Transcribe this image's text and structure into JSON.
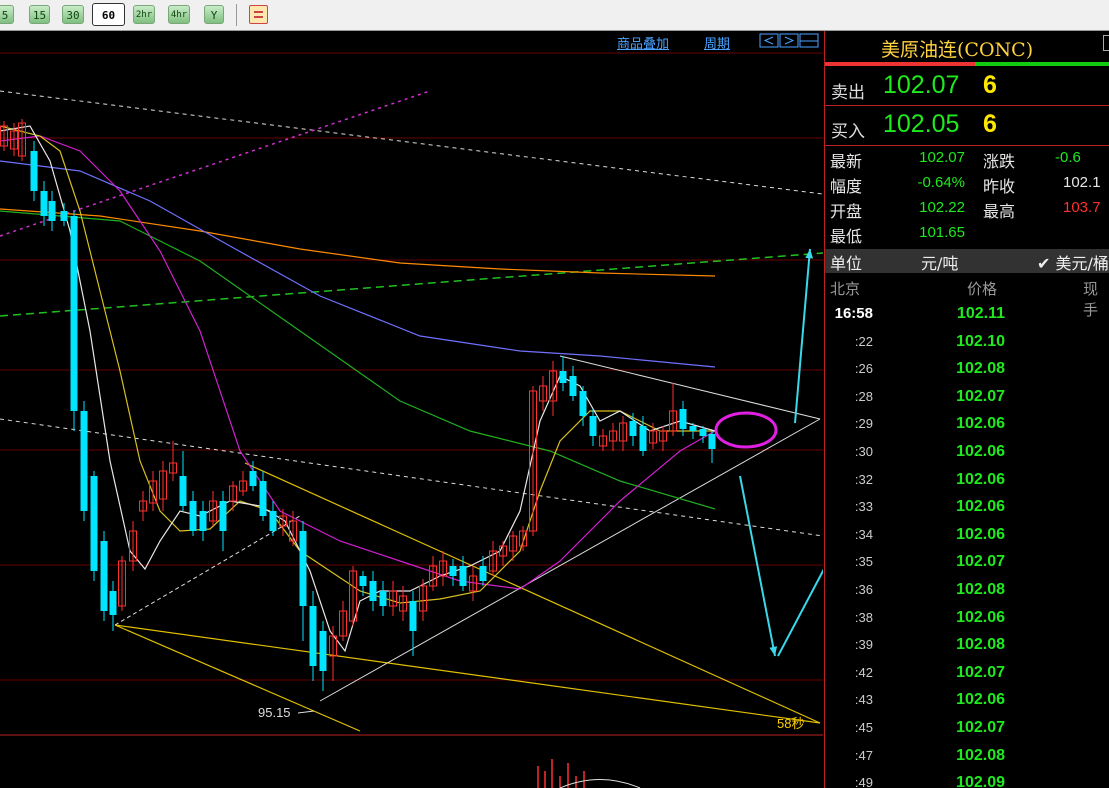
{
  "toolbar": {
    "periods": [
      {
        "label": "5",
        "active": false
      },
      {
        "label": "15",
        "active": false
      },
      {
        "label": "30",
        "active": false
      },
      {
        "label": "60",
        "active": true
      },
      {
        "label": "2hr",
        "active": false
      },
      {
        "label": "4hr",
        "active": false
      },
      {
        "label": "Y",
        "active": false
      }
    ],
    "extra_icon": "list-icon"
  },
  "chart": {
    "overlay_link": "商品叠加",
    "period_link": "周期",
    "nav_icons": [
      "scroll-left-icon",
      "scroll-right-icon",
      "layout-icon"
    ],
    "low_label": "95.15",
    "countdown": "58秒"
  },
  "chart_data": {
    "type": "candlestick",
    "instrument": "美原油连(CONC)",
    "marked_low": 95.15,
    "current_price": 102.07,
    "series_colors": {
      "up": "#ff3030",
      "down": "#00e5ff",
      "ma_fast": "#e8e8e8",
      "ma_mid": "#d8c020",
      "ma_slow": "#d020d0",
      "ma_green": "#20b020",
      "ma_blue": "#7070ff",
      "ma_orange": "#ff8a00"
    }
  },
  "quote": {
    "title": "美原油连(CONC)",
    "sell_label": "卖出",
    "sell_price": "102.07",
    "sell_vol": "6",
    "buy_label": "买入",
    "buy_price": "102.05",
    "buy_vol": "6",
    "stats": [
      {
        "label": "最新",
        "value": "102.07",
        "label2": "涨跌",
        "value2": "-0.6"
      },
      {
        "label": "幅度",
        "value": "-0.64%",
        "label2": "昨收",
        "value2": "102.1"
      },
      {
        "label": "开盘",
        "value": "102.22",
        "label2": "最高",
        "value2": "103.7"
      },
      {
        "label": "最低",
        "value": "101.65"
      }
    ],
    "unit_label": "单位",
    "unit_value": "元/吨",
    "unit_alt": "✔ 美元/桶",
    "ticks_header": {
      "time": "北京",
      "price": "价格",
      "volume": "现手"
    },
    "ticks": [
      {
        "time": "16:58",
        "price": "102.11"
      },
      {
        "time": ":22",
        "price": "102.10"
      },
      {
        "time": ":26",
        "price": "102.08"
      },
      {
        "time": ":28",
        "price": "102.07"
      },
      {
        "time": ":29",
        "price": "102.06"
      },
      {
        "time": ":30",
        "price": "102.06"
      },
      {
        "time": ":32",
        "price": "102.06"
      },
      {
        "time": ":33",
        "price": "102.06"
      },
      {
        "time": ":34",
        "price": "102.06"
      },
      {
        "time": ":35",
        "price": "102.07"
      },
      {
        "time": ":36",
        "price": "102.08"
      },
      {
        "time": ":38",
        "price": "102.06"
      },
      {
        "time": ":39",
        "price": "102.08"
      },
      {
        "time": ":42",
        "price": "102.07"
      },
      {
        "time": ":43",
        "price": "102.06"
      },
      {
        "time": ":45",
        "price": "102.07"
      },
      {
        "time": ":47",
        "price": "102.08"
      },
      {
        "time": ":49",
        "price": "102.09"
      }
    ]
  }
}
